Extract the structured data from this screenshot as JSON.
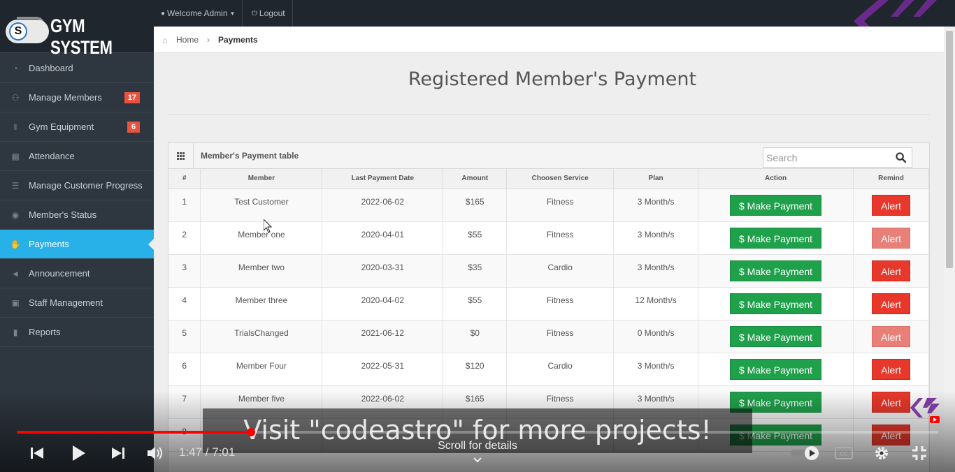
{
  "brand": {
    "badge_letter": "S",
    "name": "GYM SYSTEM"
  },
  "sidebar": {
    "items": [
      {
        "label": "Dashboard",
        "icon": "dashboard-icon",
        "badge": ""
      },
      {
        "label": "Manage Members",
        "icon": "users-icon",
        "badge": "17"
      },
      {
        "label": "Gym Equipment",
        "icon": "dumbbell-icon",
        "badge": "6"
      },
      {
        "label": "Attendance",
        "icon": "calendar-icon",
        "badge": ""
      },
      {
        "label": "Manage Customer Progress",
        "icon": "tasks-icon",
        "badge": ""
      },
      {
        "label": "Member's Status",
        "icon": "eye-icon",
        "badge": ""
      },
      {
        "label": "Payments",
        "icon": "hand-money-icon",
        "badge": "",
        "active": true
      },
      {
        "label": "Announcement",
        "icon": "bullhorn-icon",
        "badge": ""
      },
      {
        "label": "Staff Management",
        "icon": "briefcase-icon",
        "badge": ""
      },
      {
        "label": "Reports",
        "icon": "file-icon",
        "badge": ""
      }
    ]
  },
  "topbar": {
    "welcome_label": "Welcome Admin",
    "logout_label": "Logout"
  },
  "breadcrumb": {
    "home": "Home",
    "current": "Payments"
  },
  "page": {
    "title": "Registered Member's Payment"
  },
  "table": {
    "title": "Member's Payment table",
    "search_placeholder": "Search",
    "columns": [
      "#",
      "Member",
      "Last Payment Date",
      "Amount",
      "Choosen Service",
      "Plan",
      "Action",
      "Remind"
    ],
    "action_label": "$ Make Payment",
    "remind_label": "Alert",
    "rows": [
      {
        "num": "1",
        "member": "Test Customer",
        "date": "2022-06-02",
        "amount": "$165",
        "service": "Fitness",
        "plan": "3 Month/s"
      },
      {
        "num": "2",
        "member": "Member one",
        "date": "2020-04-01",
        "amount": "$55",
        "service": "Fitness",
        "plan": "3 Month/s"
      },
      {
        "num": "3",
        "member": "Member two",
        "date": "2020-03-31",
        "amount": "$35",
        "service": "Cardio",
        "plan": "3 Month/s"
      },
      {
        "num": "4",
        "member": "Member three",
        "date": "2020-04-02",
        "amount": "$55",
        "service": "Fitness",
        "plan": "12 Month/s"
      },
      {
        "num": "5",
        "member": "TrialsChanged",
        "date": "2021-06-12",
        "amount": "$0",
        "service": "Fitness",
        "plan": "0 Month/s"
      },
      {
        "num": "6",
        "member": "Member Four",
        "date": "2022-05-31",
        "amount": "$120",
        "service": "Cardio",
        "plan": "3 Month/s"
      },
      {
        "num": "7",
        "member": "Member five",
        "date": "2022-06-02",
        "amount": "$165",
        "service": "Fitness",
        "plan": "3 Month/s"
      },
      {
        "num": "8",
        "member": "",
        "date": "",
        "amount": "",
        "service": "",
        "plan": ""
      }
    ]
  },
  "video": {
    "caption": "Visit \"codeastro\" for more projects!",
    "time": "1:47 / 7:01",
    "progress": 0.254,
    "scroll_hint": "Scroll for details",
    "colors": {
      "progress": "#ff0000"
    }
  },
  "colors": {
    "active_nav": "#28b0e8",
    "pay_button": "#1fa04b",
    "alert_button": "#e8382b",
    "badge": "#e8523e"
  }
}
